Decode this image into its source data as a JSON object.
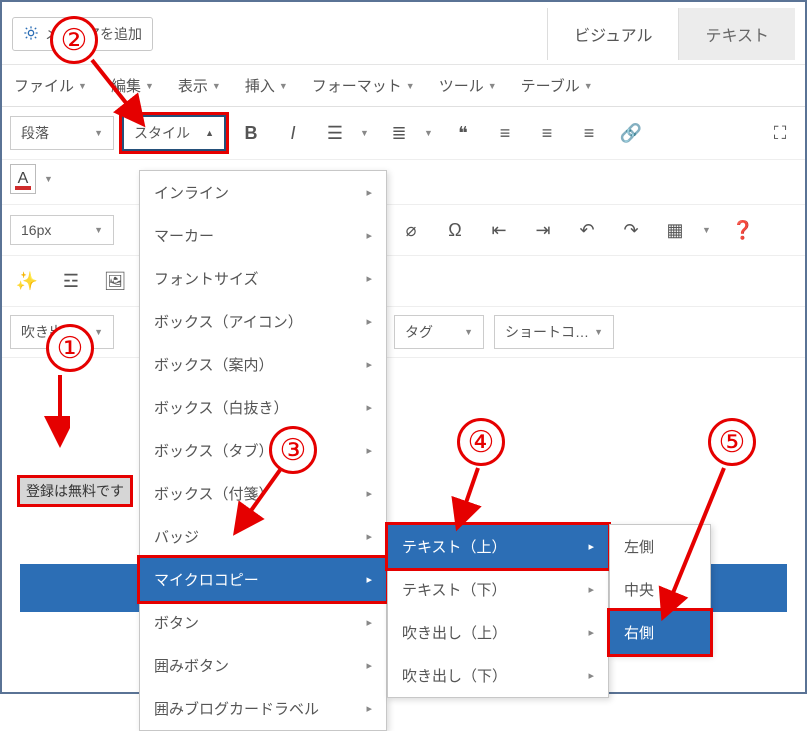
{
  "topbar": {
    "add_media": "メディアを追加",
    "tabs": {
      "visual": "ビジュアル",
      "text": "テキスト"
    }
  },
  "menubar": {
    "file": "ファイル",
    "edit": "編集",
    "view": "表示",
    "insert": "挿入",
    "format": "フォーマット",
    "tools": "ツール",
    "table": "テーブル"
  },
  "toolbar": {
    "paragraph": "段落",
    "style": "スタイル"
  },
  "row3": {
    "fontsize": "16px"
  },
  "row5": {
    "fukidashi": "吹き出し",
    "tag": "タグ",
    "shortcode": "ショートコ…"
  },
  "menu1": {
    "inline": "インライン",
    "marker": "マーカー",
    "fontsize": "フォントサイズ",
    "box_icon": "ボックス（アイコン）",
    "box_annai": "ボックス（案内）",
    "box_shironuki": "ボックス（白抜き）",
    "box_tab": "ボックス（タブ）",
    "box_fusen": "ボックス（付箋）",
    "badge": "バッジ",
    "microcopy": "マイクロコピー",
    "button": "ボタン",
    "kakomi_button": "囲みボタン",
    "kakomi_blog": "囲みブログカードラベル"
  },
  "menu2": {
    "text_top": "テキスト（上）",
    "text_bottom": "テキスト（下）",
    "fukidashi_top": "吹き出し（上）",
    "fukidashi_bottom": "吹き出し（下）"
  },
  "menu3": {
    "left": "左側",
    "center": "中央",
    "right": "右側"
  },
  "editor": {
    "sample_text": "登録は無料です"
  },
  "annotations": {
    "n1": "①",
    "n2": "②",
    "n3": "③",
    "n4": "④",
    "n5": "⑤"
  }
}
